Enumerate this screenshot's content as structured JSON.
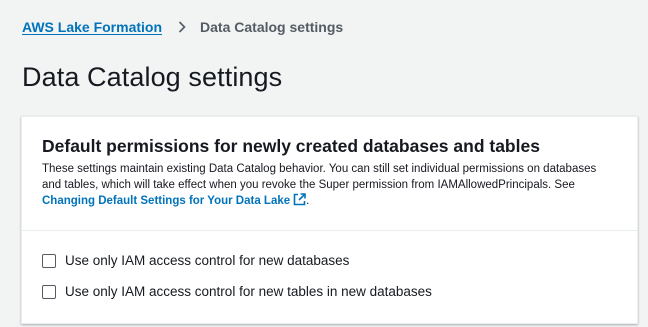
{
  "breadcrumb": {
    "root_label": "AWS Lake Formation",
    "current_label": "Data Catalog settings"
  },
  "page": {
    "title": "Data Catalog settings"
  },
  "panel": {
    "title": "Default permissions for newly created databases and tables",
    "description_text": "These settings maintain existing Data Catalog behavior. You can still set individual permissions on databases and tables, which will take effect when you revoke the Super permission from IAMAllowedPrincipals. See ",
    "description_link": "Changing Default Settings for Your Data Lake",
    "description_end": ".",
    "options": [
      {
        "label": "Use only IAM access control for new databases",
        "checked": false
      },
      {
        "label": "Use only IAM access control for new tables in new databases",
        "checked": false
      }
    ]
  },
  "icons": {
    "separator": "chevron-right-icon",
    "external_link": "external-link-icon"
  },
  "colors": {
    "link": "#0073bb",
    "background": "#f2f3f3",
    "text": "#16191f",
    "muted": "#545b64"
  }
}
